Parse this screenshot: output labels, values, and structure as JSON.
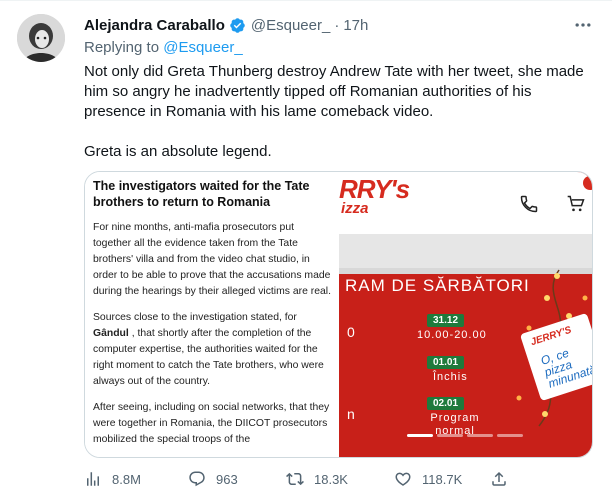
{
  "author": {
    "name": "Alejandra Caraballo",
    "handle": "@Esqueer_",
    "separator": "·",
    "time": "17h",
    "verified": true
  },
  "reply": {
    "prefix": "Replying to",
    "mention": "@Esqueer_"
  },
  "tweet": {
    "paragraph1": "Not only did Greta Thunberg destroy Andrew Tate with her tweet, she made him so angry he inadvertently tipped off Romanian authorities of his presence in Romania with his lame comeback video.",
    "paragraph2": "Greta is an absolute legend."
  },
  "media": {
    "article": {
      "title": "The investigators waited for the Tate brothers to return to Romania",
      "para1": "For nine months, anti-mafia prosecutors put together all the evidence taken from the Tate brothers' villa and from the video chat studio, in order to be able to prove that the accusations made during the hearings by their alleged victims are real.",
      "para2_before": "Sources close to the investigation stated, for",
      "para2_bold": "Gândul",
      "para2_after": ", that shortly after the completion of the computer expertise, the authorities waited for the right moment to catch the Tate brothers, who were always out of the country.",
      "para3": "After seeing, including on social networks, that they were together in Romania, the DIICOT prosecutors mobilized the special troops of the"
    },
    "photo": {
      "logo_top": "RRY's",
      "logo_bottom": "izza",
      "headline": "RAM DE SĂRBĂTORI",
      "schedule": [
        {
          "date": "31.12",
          "hours": "10.00-20.00"
        },
        {
          "date": "01.01",
          "hours": "Închis"
        },
        {
          "date": "02.01",
          "hours": "Program normal"
        }
      ],
      "side_chars": [
        "0",
        "n"
      ],
      "box_logo": "JERRY'S",
      "box_text": "O, ce pizza minunată"
    }
  },
  "actions": {
    "views": "8.8M",
    "replies": "963",
    "retweets": "18.3K",
    "likes": "118.7K"
  },
  "colors": {
    "accent": "#1d9bf0",
    "muted": "#536471",
    "pizza_red": "#c82019",
    "pill_green": "#1f7a3c"
  }
}
